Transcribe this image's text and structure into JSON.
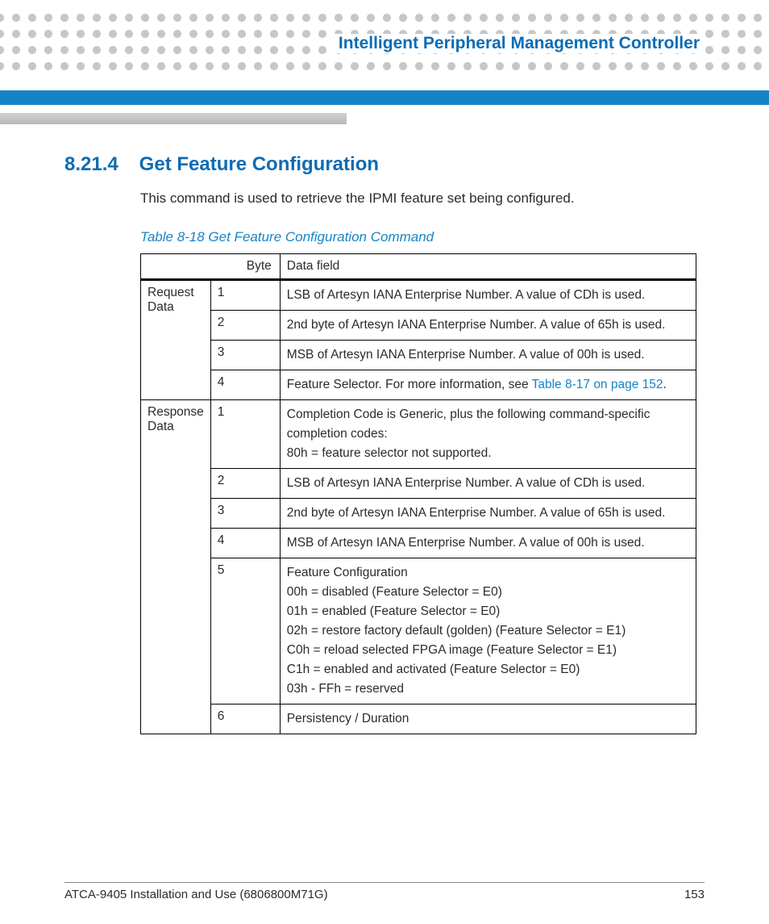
{
  "chapter_title": "Intelligent Peripheral Management Controller",
  "section": {
    "number": "8.21.4",
    "title": "Get Feature Configuration",
    "intro": "This command is used to retrieve the IPMI feature set being configured."
  },
  "table_caption": "Table 8-18 Get Feature Configuration Command",
  "headers": {
    "byte": "Byte",
    "data_field": "Data field"
  },
  "groups": {
    "request": "Request Data",
    "response": "Response Data"
  },
  "request_rows": [
    {
      "byte": "1",
      "lines": [
        "LSB of Artesyn IANA Enterprise Number. A value of CDh is used."
      ]
    },
    {
      "byte": "2",
      "lines": [
        "2nd byte of Artesyn IANA Enterprise Number. A value of 65h is used."
      ]
    },
    {
      "byte": "3",
      "lines": [
        "MSB of Artesyn IANA Enterprise Number. A value of 00h is used."
      ]
    },
    {
      "byte": "4",
      "lines": [
        "Feature Selector. For more information, see "
      ],
      "link": "Table 8-17 on page 152",
      "after_link": "."
    }
  ],
  "response_rows": [
    {
      "byte": "1",
      "lines": [
        "Completion Code is Generic, plus the following command-specific completion codes:",
        "80h = feature selector not supported."
      ]
    },
    {
      "byte": "2",
      "lines": [
        "LSB of Artesyn IANA Enterprise Number. A value of CDh is used."
      ]
    },
    {
      "byte": "3",
      "lines": [
        "2nd byte of Artesyn IANA Enterprise Number. A value of 65h is used."
      ]
    },
    {
      "byte": "4",
      "lines": [
        "MSB of Artesyn IANA Enterprise Number. A value of 00h is used."
      ]
    },
    {
      "byte": "5",
      "lines": [
        "Feature Configuration",
        "00h = disabled (Feature Selector = E0)",
        "01h = enabled (Feature Selector = E0)",
        "02h = restore factory default (golden) (Feature Selector = E1)",
        "C0h = reload selected FPGA image (Feature Selector = E1)",
        "C1h = enabled and activated (Feature Selector = E0)",
        "03h - FFh = reserved"
      ]
    },
    {
      "byte": "6",
      "lines": [
        "Persistency / Duration"
      ]
    }
  ],
  "footer": {
    "doc": "ATCA-9405 Installation and Use (6806800M71G)",
    "page": "153"
  }
}
